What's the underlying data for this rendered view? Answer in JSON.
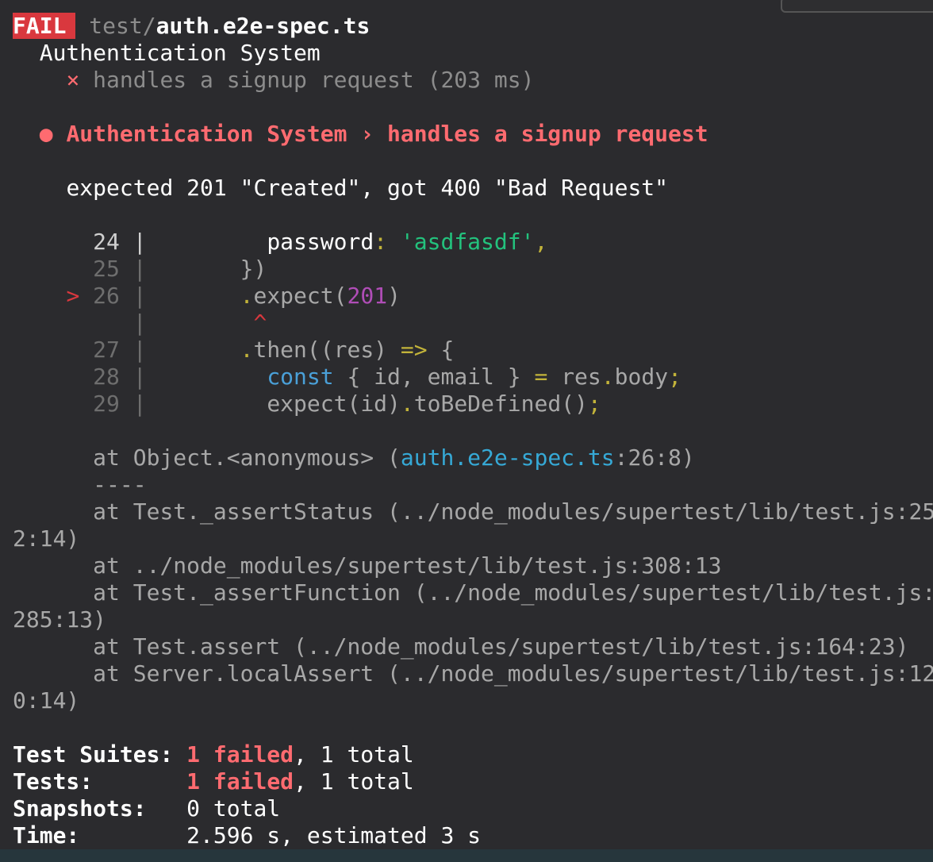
{
  "header": {
    "badge": "FAIL",
    "path_dir": "test/",
    "path_file": "auth.e2e-spec.ts"
  },
  "suite": {
    "name": "Authentication System",
    "test_mark": "×",
    "test_name": "handles a signup request (203 ms)"
  },
  "error": {
    "bullet": "●",
    "title": "Authentication System › handles a signup request",
    "message": "expected 201 \"Created\", got 400 \"Bad Request\""
  },
  "code": {
    "l24_num": "24",
    "l24_a": "password",
    "l24_b": ":",
    "l24_c": "'asdfasdf'",
    "l24_d": ",",
    "l25_num": "25",
    "l25_text": "})",
    "l26_marker": ">",
    "l26_num": "26",
    "l26_a": ".",
    "l26_b": "expect(",
    "l26_c": "201",
    "l26_d": ")",
    "caret": "^",
    "l27_num": "27",
    "l27_a": ".",
    "l27_b": "then((res) ",
    "l27_c": "=>",
    "l27_d": " {",
    "l28_num": "28",
    "l28_a": "const",
    "l28_b": " { id, email } ",
    "l28_c": "=",
    "l28_d": " res",
    "l28_e": ".",
    "l28_f": "body",
    "l28_g": ";",
    "l29_num": "29",
    "l29_a": "expect(id)",
    "l29_b": ".",
    "l29_c": "toBeDefined()",
    "l29_d": ";",
    "pipe": "|"
  },
  "stack": {
    "at_object_pre": "at Object.<anonymous> (",
    "at_object_file": "auth.e2e-spec.ts",
    "at_object_post": ":26:8)",
    "separator": "----",
    "frame1a": "at Test._assertStatus (../node_modules/supertest/lib/test.js:25",
    "frame1b": "2:14)",
    "frame2": "at ../node_modules/supertest/lib/test.js:308:13",
    "frame3a": "at Test._assertFunction (../node_modules/supertest/lib/test.js:",
    "frame3b": "285:13)",
    "frame4": "at Test.assert (../node_modules/supertest/lib/test.js:164:23)",
    "frame5a": "at Server.localAssert (../node_modules/supertest/lib/test.js:12",
    "frame5b": "0:14)"
  },
  "summary": {
    "suites_label": "Test Suites:",
    "suites_failed": "1 failed",
    "suites_total": ", 1 total",
    "tests_label": "Tests:",
    "tests_failed": "1 failed",
    "tests_total": ", 1 total",
    "snapshots_label": "Snapshots:",
    "snapshots_value": "0 total",
    "time_label": "Time:",
    "time_value": "2.596 s, estimated 3 s"
  },
  "colors": {
    "background": "#2b2b2e",
    "fail_badge": "#d9383e",
    "failure_text": "#ff6b70",
    "string": "#23c27d",
    "link": "#36a9d6"
  }
}
